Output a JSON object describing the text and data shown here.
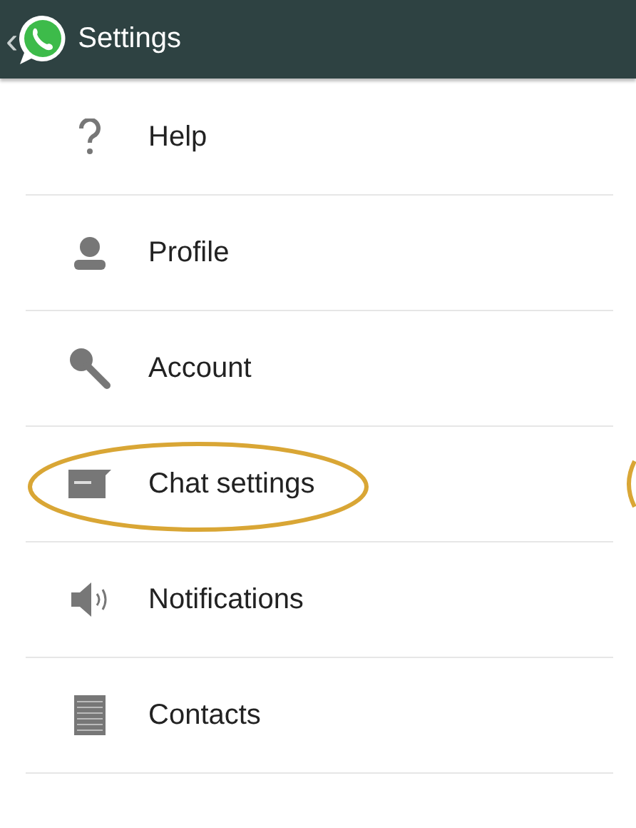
{
  "header": {
    "back": "‹",
    "title": "Settings"
  },
  "items": [
    {
      "label": "Help",
      "highlighted": false
    },
    {
      "label": "Profile",
      "highlighted": false
    },
    {
      "label": "Account",
      "highlighted": false
    },
    {
      "label": "Chat settings",
      "highlighted": true
    },
    {
      "label": "Notifications",
      "highlighted": false
    },
    {
      "label": "Contacts",
      "highlighted": false
    }
  ]
}
